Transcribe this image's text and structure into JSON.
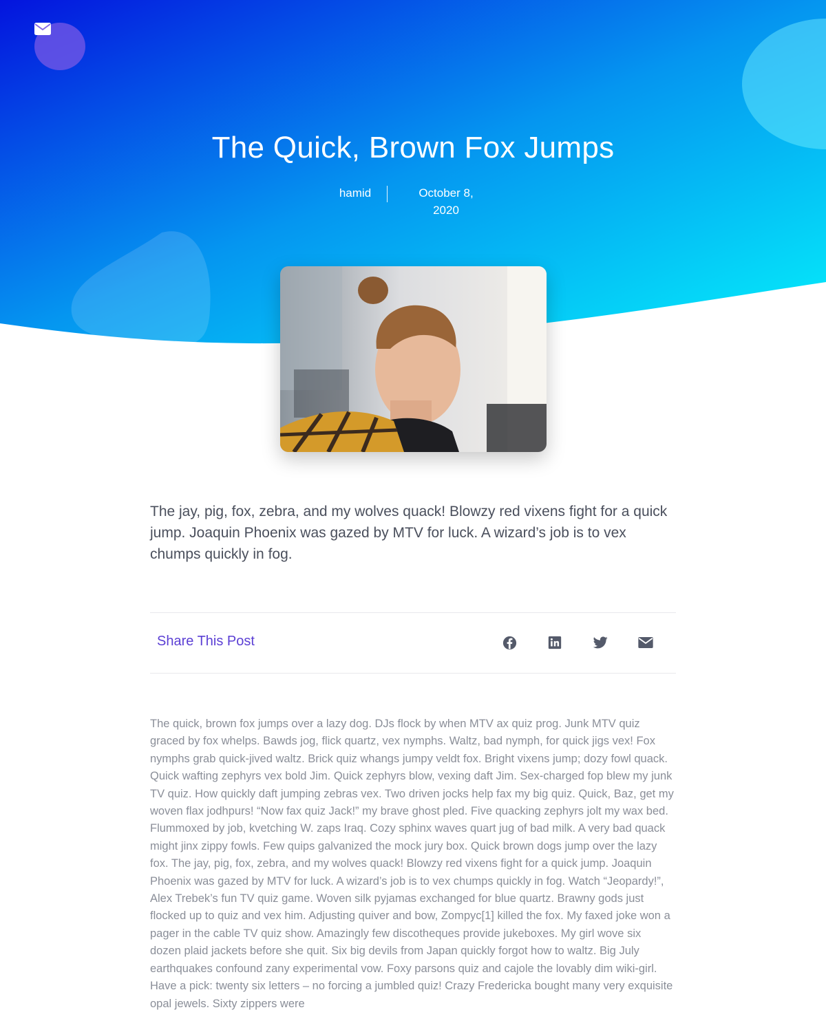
{
  "header": {
    "title": "The Quick, Brown Fox Jumps",
    "author": "hamid",
    "date": "October 8, 2020",
    "mail_icon": "envelope-icon"
  },
  "colors": {
    "hero_gradient_start": "#0414de",
    "hero_gradient_mid": "#0596f0",
    "hero_gradient_end": "#05f0fb",
    "accent": "#5b3fd4",
    "lead_text": "#4a4f5c",
    "body_text": "#8a8e98",
    "icon": "#545a6a"
  },
  "lead": "The jay, pig, fox, zebra, and my wolves quack! Blowzy red vixens fight for a quick jump. Joaquin Phoenix was gazed by MTV for luck. A wizard’s job is to vex chumps quickly in fog.",
  "share": {
    "label": "Share This Post",
    "icons": [
      "facebook-icon",
      "linkedin-icon",
      "twitter-icon",
      "envelope-icon"
    ]
  },
  "body": "The quick, brown fox jumps over a lazy dog. DJs flock by when MTV ax quiz prog. Junk MTV quiz graced by fox whelps. Bawds jog, flick quartz, vex nymphs. Waltz, bad nymph, for quick jigs vex! Fox nymphs grab quick-jived waltz. Brick quiz whangs jumpy veldt fox. Bright vixens jump; dozy fowl quack. Quick wafting zephyrs vex bold Jim. Quick zephyrs blow, vexing daft Jim. Sex-charged fop blew my junk TV quiz. How quickly daft jumping zebras vex. Two driven jocks help fax my big quiz. Quick, Baz, get my woven flax jodhpurs! “Now fax quiz Jack!” my brave ghost pled. Five quacking zephyrs jolt my wax bed. Flummoxed by job, kvetching W. zaps Iraq. Cozy sphinx waves quart jug of bad milk. A very bad quack might jinx zippy fowls. Few quips galvanized the mock jury box. Quick brown dogs jump over the lazy fox. The jay, pig, fox, zebra, and my wolves quack! Blowzy red vixens fight for a quick jump. Joaquin Phoenix was gazed by MTV for luck. A wizard’s job is to vex chumps quickly in fog. Watch “Jeopardy!”, Alex Trebek’s fun TV quiz game. Woven silk pyjamas exchanged for blue quartz. Brawny gods just flocked up to quiz and vex him. Adjusting quiver and bow, Zompyc[1] killed the fox. My faxed joke won a pager in the cable TV quiz show. Amazingly few discotheques provide jukeboxes. My girl wove six dozen plaid jackets before she quit. Six big devils from Japan quickly forgot how to waltz. Big July earthquakes confound zany experimental vow. Foxy parsons quiz and cajole the lovably dim wiki-girl. Have a pick: twenty six letters – no forcing a jumbled quiz! Crazy Fredericka bought many very exquisite opal jewels. Sixty zippers were"
}
